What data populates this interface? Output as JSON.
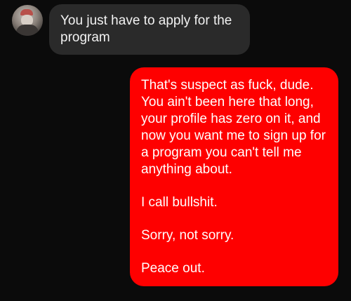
{
  "conversation": {
    "incoming": {
      "avatar_icon": "user-avatar-photo",
      "text": "You just have to apply for the program"
    },
    "outgoing": {
      "bubble_color": "#fe0000",
      "paragraphs": [
        "That's suspect as fuck, dude. You ain't been here that long, your profile has zero on it, and now you want me to sign up for a program you can't tell me anything about.",
        "I call bullshit.",
        "Sorry, not sorry.",
        "Peace out."
      ]
    }
  }
}
